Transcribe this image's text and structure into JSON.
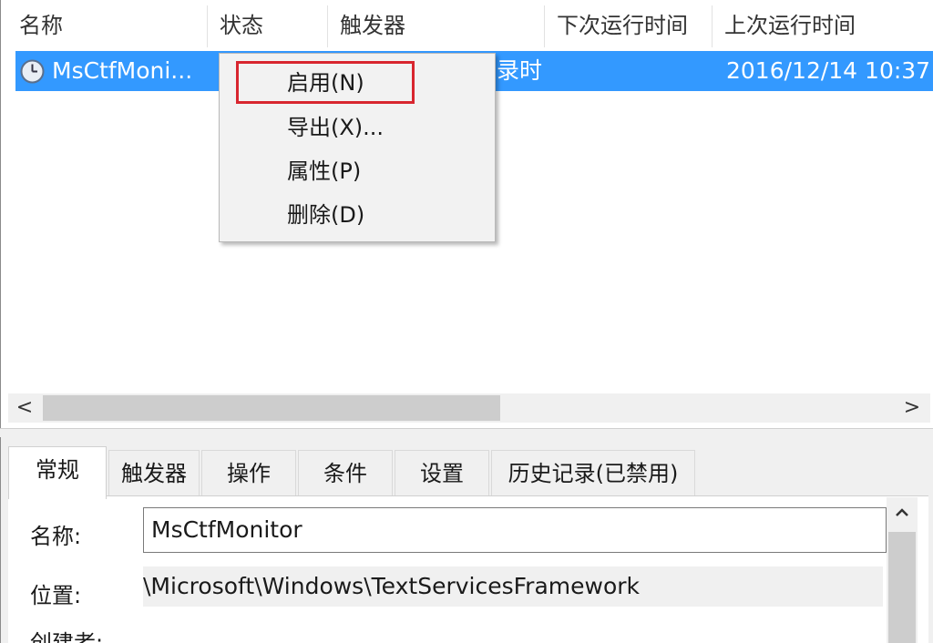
{
  "columns": {
    "name": "名称",
    "status": "状态",
    "triggers": "触发器",
    "next_run": "下次运行时间",
    "last_run": "上次运行时间"
  },
  "task": {
    "name": "MsCtfMoni...",
    "trigger_partial": "录时",
    "last_run": "2016/12/14 10:37"
  },
  "context_menu": {
    "items": [
      {
        "label": "启用(N)",
        "highlighted": true
      },
      {
        "label": "导出(X)..."
      },
      {
        "label": "属性(P)"
      },
      {
        "label": "删除(D)"
      }
    ]
  },
  "tabs": [
    {
      "label": "常规",
      "active": true
    },
    {
      "label": "触发器"
    },
    {
      "label": "操作"
    },
    {
      "label": "条件"
    },
    {
      "label": "设置"
    },
    {
      "label": "历史记录(已禁用)"
    }
  ],
  "general": {
    "name_label": "名称:",
    "name_value": "MsCtfMonitor",
    "location_label": "位置:",
    "location_value": "\\Microsoft\\Windows\\TextServicesFramework",
    "author_label": "创建者:"
  },
  "scrollbar": {
    "left_arrow": "<",
    "right_arrow": ">",
    "up_arrow": "^"
  },
  "colors": {
    "selection": "#3399ff",
    "highlight_box": "#d8262f",
    "menu_bg": "#f2f2f2"
  },
  "icons": {
    "task": "clock-icon",
    "scroll_left": "chevron-left-icon",
    "scroll_right": "chevron-right-icon",
    "scroll_up": "chevron-up-icon"
  }
}
